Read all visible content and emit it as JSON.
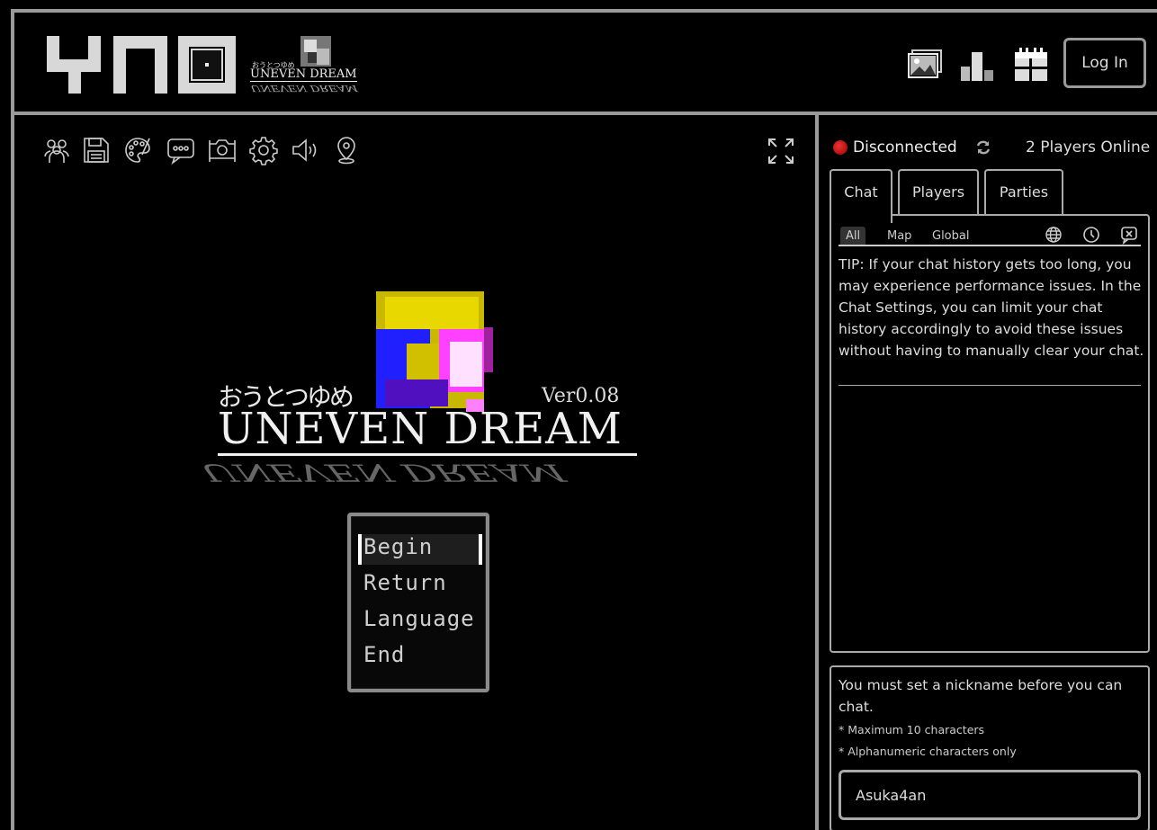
{
  "header": {
    "site_logo": "YNO",
    "game_logo": {
      "jp_text": "おうとつゆめ",
      "en_text": "UNEVEN DREAM",
      "mirror_text": "UNEVEN DREAM"
    },
    "icons": [
      "gallery-icon",
      "leaderboard-icon",
      "calendar-icon"
    ],
    "login_label": "Log In"
  },
  "game": {
    "toolbar_icons": [
      "players-icon",
      "save-icon",
      "palette-icon",
      "chat-bubble-icon",
      "camera-icon",
      "settings-icon",
      "volume-icon",
      "location-pin-icon"
    ],
    "title_jp": "おうとつゆめ",
    "version": "Ver0.08",
    "title_en": "UNEVEN DREAM",
    "title_mirror": "UNEVEN DREAM",
    "menu": [
      "Begin",
      "Return",
      "Language",
      "End"
    ],
    "selected_menu_index": 0
  },
  "side": {
    "status": "Disconnected",
    "status_color": "#cc2222",
    "players_online": "2 Players Online",
    "tabs": [
      "Chat",
      "Players",
      "Parties"
    ],
    "active_tab": "Chat",
    "filters": [
      "All",
      "Map",
      "Global"
    ],
    "active_filter": "All",
    "chat_icons": [
      "globe-icon",
      "clock-icon",
      "clear-chat-icon"
    ],
    "tip": "TIP: If your chat history gets too long, you may experience performance issues. In the Chat Settings, you can limit your chat history accordingly to avoid these issues without having to manually clear your chat.",
    "nick": {
      "message": "You must set a nickname before you can chat.",
      "rules": [
        "* Maximum 10 characters",
        "* Alphanumeric characters only"
      ],
      "value": "Asuka4an"
    }
  },
  "colors": {
    "border": "#9a9a9a",
    "art_yellow": "#e8d800",
    "art_blue": "#2020ff",
    "art_magenta": "#ff40ff"
  }
}
